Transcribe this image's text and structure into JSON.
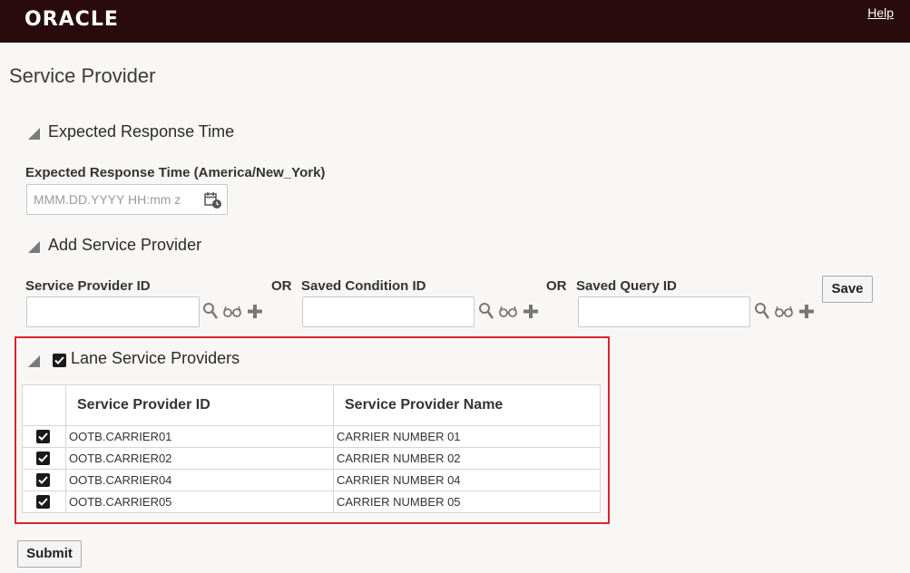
{
  "header": {
    "logo_text": "ORACLE",
    "help_link": "Help"
  },
  "page": {
    "title": "Service Provider"
  },
  "expected_response": {
    "section_title": "Expected Response Time",
    "field_label": "Expected Response Time (America/New_York)",
    "placeholder": "MMM.DD.YYYY HH:mm z",
    "calendar_icon": "calendar-clock-icon"
  },
  "add_provider": {
    "section_title": "Add Service Provider",
    "provider_id_label": "Service Provider ID",
    "or_label": "OR",
    "saved_condition_label": "Saved Condition ID",
    "saved_query_label": "Saved Query ID",
    "save_button": "Save",
    "icons": [
      "search-icon",
      "glasses-icon",
      "plus-icon"
    ]
  },
  "lane_providers": {
    "section_title": "Lane Service Providers",
    "header_checked": true,
    "columns": [
      "Service Provider ID",
      "Service Provider Name"
    ],
    "rows": [
      {
        "checked": true,
        "id": "OOTB.CARRIER01",
        "name": "CARRIER NUMBER 01"
      },
      {
        "checked": true,
        "id": "OOTB.CARRIER02",
        "name": "CARRIER NUMBER 02"
      },
      {
        "checked": true,
        "id": "OOTB.CARRIER04",
        "name": "CARRIER NUMBER 04"
      },
      {
        "checked": true,
        "id": "OOTB.CARRIER05",
        "name": "CARRIER NUMBER 05"
      }
    ],
    "highlight_color": "#d9252b"
  },
  "footer": {
    "submit_button": "Submit"
  },
  "colors": {
    "topbar": "#2a0b0d",
    "background": "#f8f7f5"
  }
}
